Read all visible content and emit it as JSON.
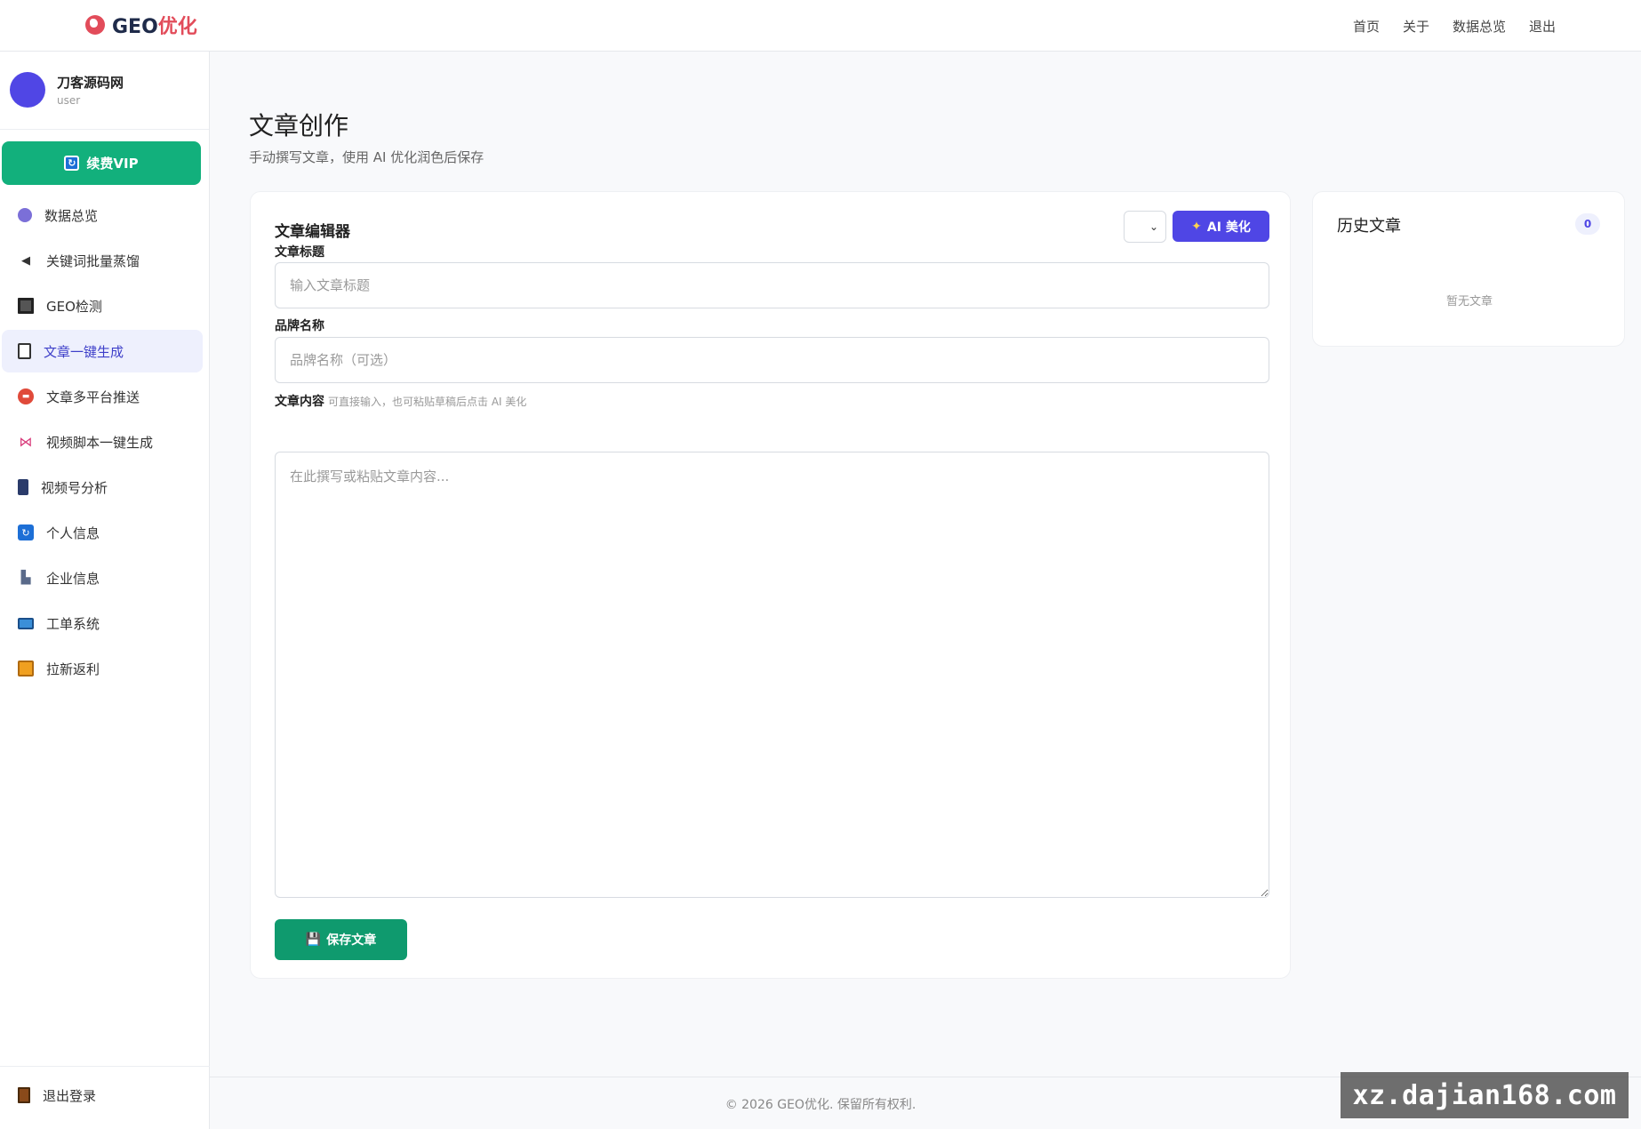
{
  "brand": {
    "prefix": "GEO",
    "suffix": "优化"
  },
  "topnav": [
    "首页",
    "关于",
    "数据总览",
    "退出"
  ],
  "profile": {
    "name": "刀客源码网",
    "role": "user"
  },
  "vip_button": "续费VIP",
  "menu": [
    {
      "label": "数据总览",
      "icon": "chart-icon",
      "active": false
    },
    {
      "label": "关键词批量蒸馏",
      "icon": "speaker-icon",
      "active": false
    },
    {
      "label": "GEO检测",
      "icon": "square-icon",
      "active": false
    },
    {
      "label": "文章一键生成",
      "icon": "document-icon",
      "active": true
    },
    {
      "label": "文章多平台推送",
      "icon": "push-icon",
      "active": false
    },
    {
      "label": "视频脚本一键生成",
      "icon": "bow-icon",
      "active": false
    },
    {
      "label": "视频号分析",
      "icon": "phone-icon",
      "active": false
    },
    {
      "label": "个人信息",
      "icon": "refresh-icon",
      "active": false
    },
    {
      "label": "企业信息",
      "icon": "building-icon",
      "active": false
    },
    {
      "label": "工单系统",
      "icon": "ticket-icon",
      "active": false
    },
    {
      "label": "拉新返利",
      "icon": "gift-icon",
      "active": false
    }
  ],
  "logout": "退出登录",
  "page": {
    "title": "文章创作",
    "subtitle": "手动撰写文章，使用 AI 优化润色后保存"
  },
  "editor": {
    "title": "文章编辑器",
    "ai_button": "AI 美化",
    "title_label": "文章标题",
    "title_placeholder": "输入文章标题",
    "brand_label": "品牌名称",
    "brand_placeholder": "品牌名称（可选）",
    "content_label": "文章内容",
    "content_hint": "可直接输入，也可粘贴草稿后点击 AI 美化",
    "content_placeholder": "在此撰写或粘贴文章内容...",
    "save_button": "保存文章"
  },
  "history": {
    "title": "历史文章",
    "count": "0",
    "empty": "暂无文章"
  },
  "footer": "© 2026 GEO优化. 保留所有权利.",
  "watermark": "xz.dajian168.com",
  "colors": {
    "accent": "#4f46e5",
    "success": "#12b07c",
    "save": "#0f9a6e",
    "brand_red": "#e24c5a"
  }
}
